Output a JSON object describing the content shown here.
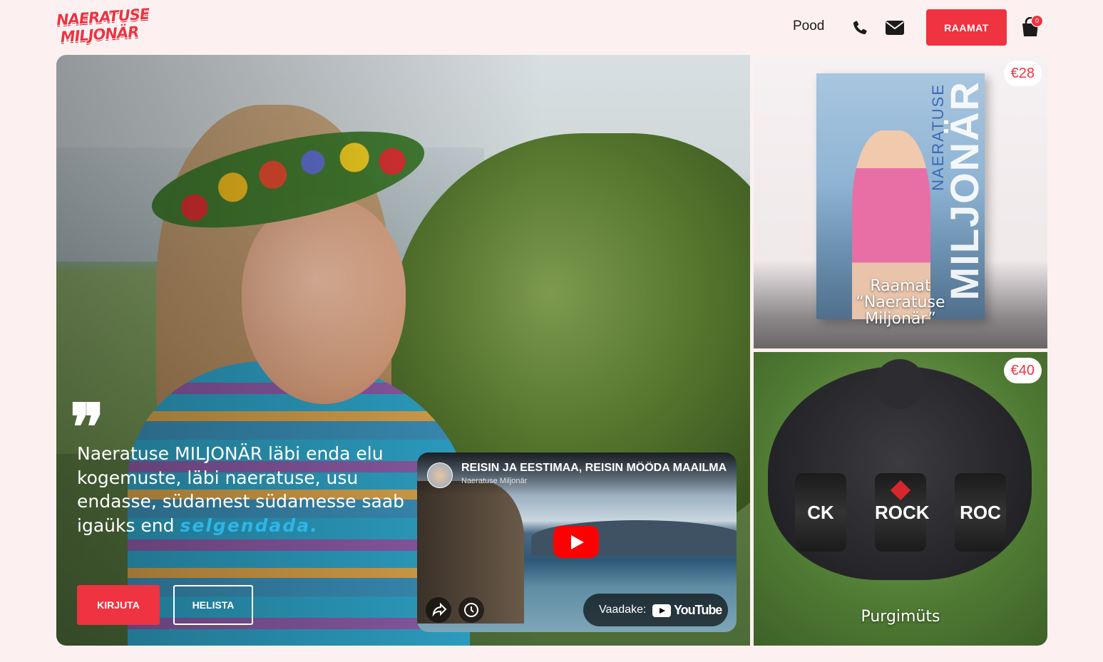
{
  "header": {
    "logo_line1": "NAERATUSE",
    "logo_line2": "MILJONÄR",
    "nav_shop": "Pood",
    "cta_label": "RAAMAT",
    "cart_count": "0",
    "icons": [
      "phone-icon",
      "mail-icon",
      "cart-icon"
    ]
  },
  "hero": {
    "quote_mark": "❞",
    "text_main": "Naeratuse MILJONÄR läbi enda elu kogemuste, läbi naeratuse, usu endasse, südamest südamesse saab igaüks end",
    "text_accent": "selgendada.",
    "button_write": "KIRJUTA",
    "button_call": "HELISTA"
  },
  "video": {
    "title": "REISIN JA EESTIMAA, REISIN MÖÖDA MAAILMA",
    "channel": "Naeratuse Miljonär",
    "watch_label": "Vaadake:",
    "youtube_word": "YouTube"
  },
  "products": [
    {
      "price": "€28",
      "label_line1": "Raamat",
      "label_line2": "“Naeratuse",
      "label_line3": "Miljonär”",
      "cover_small": "NAERATUSE",
      "cover_big": "MILJONÄR"
    },
    {
      "price": "€40",
      "label_line1": "Purgimüts",
      "can_left": "CK",
      "can_mid": "ROCK",
      "can_right": "ROC"
    }
  ],
  "colors": {
    "accent": "#ef3340",
    "background": "#fdf0f0",
    "highlight": "#2fb5e8"
  }
}
